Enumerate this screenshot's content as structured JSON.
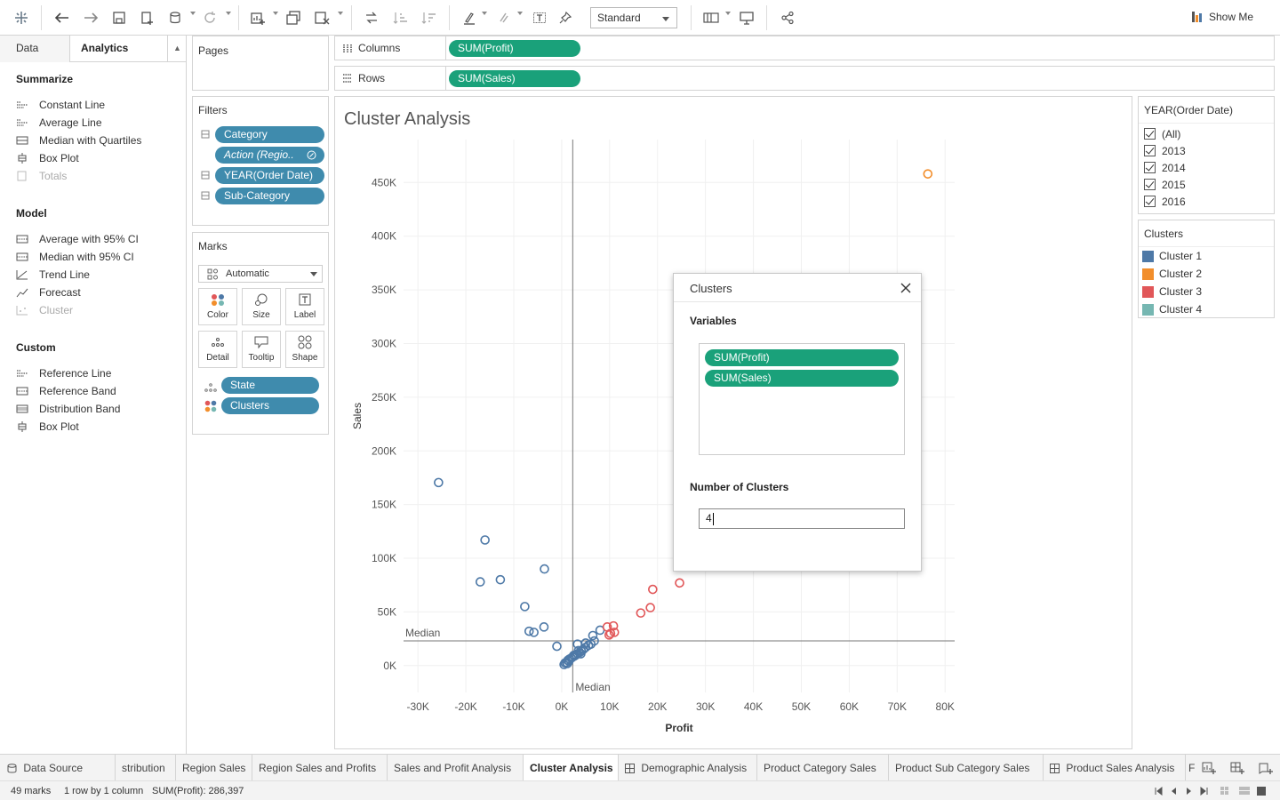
{
  "toolbar": {
    "view_mode": "Standard",
    "show_me_label": "Show Me"
  },
  "side_panel": {
    "tab_data": "Data",
    "tab_analytics": "Analytics",
    "summarize": {
      "heading": "Summarize",
      "items": [
        "Constant Line",
        "Average Line",
        "Median with Quartiles",
        "Box Plot",
        "Totals"
      ]
    },
    "model": {
      "heading": "Model",
      "items": [
        "Average with 95% CI",
        "Median with 95% CI",
        "Trend Line",
        "Forecast",
        "Cluster"
      ]
    },
    "custom": {
      "heading": "Custom",
      "items": [
        "Reference Line",
        "Reference Band",
        "Distribution Band",
        "Box Plot"
      ]
    }
  },
  "pages": {
    "title": "Pages"
  },
  "filters": {
    "title": "Filters",
    "items": [
      "Category",
      "Action (Regio..",
      "YEAR(Order Date)",
      "Sub-Category"
    ]
  },
  "marks": {
    "title": "Marks",
    "type": "Automatic",
    "buttons": [
      "Color",
      "Size",
      "Label",
      "Detail",
      "Tooltip",
      "Shape"
    ],
    "fields": [
      "State",
      "Clusters"
    ]
  },
  "shelves": {
    "columns_label": "Columns",
    "columns_pill": "SUM(Profit)",
    "rows_label": "Rows",
    "rows_pill": "SUM(Sales)"
  },
  "year_filter": {
    "title": "YEAR(Order Date)",
    "options": [
      "(All)",
      "2013",
      "2014",
      "2015",
      "2016"
    ]
  },
  "clusters_legend": {
    "title": "Clusters",
    "items": [
      {
        "label": "Cluster 1",
        "color": "#4e79a7"
      },
      {
        "label": "Cluster 2",
        "color": "#f28e2b"
      },
      {
        "label": "Cluster 3",
        "color": "#e15759"
      },
      {
        "label": "Cluster 4",
        "color": "#76b7b2"
      }
    ]
  },
  "dialog": {
    "title": "Clusters",
    "variables_label": "Variables",
    "variables": [
      "SUM(Profit)",
      "SUM(Sales)"
    ],
    "num_clusters_label": "Number of Clusters",
    "num_clusters_value": "4"
  },
  "sheet_tabs": [
    {
      "label": "Data Source",
      "active": false
    },
    {
      "label": "stribution",
      "active": false
    },
    {
      "label": "Region Sales",
      "active": false
    },
    {
      "label": "Region Sales and Profits",
      "active": false
    },
    {
      "label": "Sales and Profit Analysis",
      "active": false
    },
    {
      "label": "Cluster Analysis",
      "active": true
    },
    {
      "label": "Demographic Analysis",
      "active": false
    },
    {
      "label": "Product Category Sales",
      "active": false
    },
    {
      "label": "Product Sub Category Sales",
      "active": false
    },
    {
      "label": "Product Sales Analysis",
      "active": false
    },
    {
      "label": "F",
      "active": false
    }
  ],
  "status": {
    "marks": "49 marks",
    "layout": "1 row by 1 column",
    "sum": "SUM(Profit): 286,397"
  },
  "chart_data": {
    "type": "scatter",
    "title": "Cluster Analysis",
    "xlabel": "Profit",
    "ylabel": "Sales",
    "xlim": [
      -33000,
      82000
    ],
    "ylim": [
      -25000,
      490000
    ],
    "x_ticks": [
      {
        "v": -30000,
        "label": "-30K"
      },
      {
        "v": -20000,
        "label": "-20K"
      },
      {
        "v": -10000,
        "label": "-10K"
      },
      {
        "v": 0,
        "label": "0K"
      },
      {
        "v": 10000,
        "label": "10K"
      },
      {
        "v": 20000,
        "label": "20K"
      },
      {
        "v": 30000,
        "label": "30K"
      },
      {
        "v": 40000,
        "label": "40K"
      },
      {
        "v": 50000,
        "label": "50K"
      },
      {
        "v": 60000,
        "label": "60K"
      },
      {
        "v": 70000,
        "label": "70K"
      },
      {
        "v": 80000,
        "label": "80K"
      }
    ],
    "y_ticks": [
      {
        "v": 0,
        "label": "0K"
      },
      {
        "v": 50000,
        "label": "50K"
      },
      {
        "v": 100000,
        "label": "100K"
      },
      {
        "v": 150000,
        "label": "150K"
      },
      {
        "v": 200000,
        "label": "200K"
      },
      {
        "v": 250000,
        "label": "250K"
      },
      {
        "v": 300000,
        "label": "300K"
      },
      {
        "v": 350000,
        "label": "350K"
      },
      {
        "v": 400000,
        "label": "400K"
      },
      {
        "v": 450000,
        "label": "450K"
      }
    ],
    "median_x": 2300,
    "median_y": 23000,
    "median_label": "Median",
    "series": [
      {
        "cluster": 1,
        "color": "#4e79a7",
        "points": [
          [
            -25700,
            170500
          ],
          [
            -16000,
            117000
          ],
          [
            -17000,
            78000
          ],
          [
            -12800,
            80000
          ],
          [
            -3600,
            90000
          ],
          [
            -7700,
            55000
          ],
          [
            -6800,
            32000
          ],
          [
            -5800,
            31000
          ],
          [
            -3700,
            36000
          ],
          [
            -1000,
            18000
          ],
          [
            3300,
            20000
          ],
          [
            5000,
            21000
          ],
          [
            6100,
            20000
          ],
          [
            6800,
            23000
          ],
          [
            6500,
            28000
          ],
          [
            8000,
            33000
          ],
          [
            500,
            1000
          ],
          [
            700,
            2500
          ],
          [
            1000,
            3000
          ],
          [
            1300,
            5000
          ],
          [
            1600,
            6000
          ],
          [
            2000,
            7000
          ],
          [
            2300,
            8000
          ],
          [
            2700,
            9000
          ],
          [
            3000,
            10000
          ],
          [
            3300,
            11000
          ],
          [
            3700,
            12000
          ],
          [
            4100,
            13500
          ],
          [
            4500,
            15000
          ],
          [
            1500,
            4000
          ],
          [
            2500,
            9500
          ],
          [
            3500,
            14000
          ],
          [
            5000,
            17000
          ],
          [
            5600,
            19000
          ],
          [
            4000,
            11000
          ],
          [
            1200,
            2000
          ]
        ]
      },
      {
        "cluster": 2,
        "color": "#f28e2b",
        "points": [
          [
            76400,
            458000
          ]
        ]
      },
      {
        "cluster": 3,
        "color": "#e15759",
        "points": [
          [
            19000,
            71000
          ],
          [
            24600,
            77000
          ],
          [
            16500,
            49000
          ],
          [
            18500,
            54000
          ],
          [
            9500,
            36000
          ],
          [
            10800,
            37000
          ],
          [
            9900,
            28500
          ],
          [
            11000,
            31000
          ],
          [
            10200,
            30000
          ]
        ]
      }
    ]
  }
}
